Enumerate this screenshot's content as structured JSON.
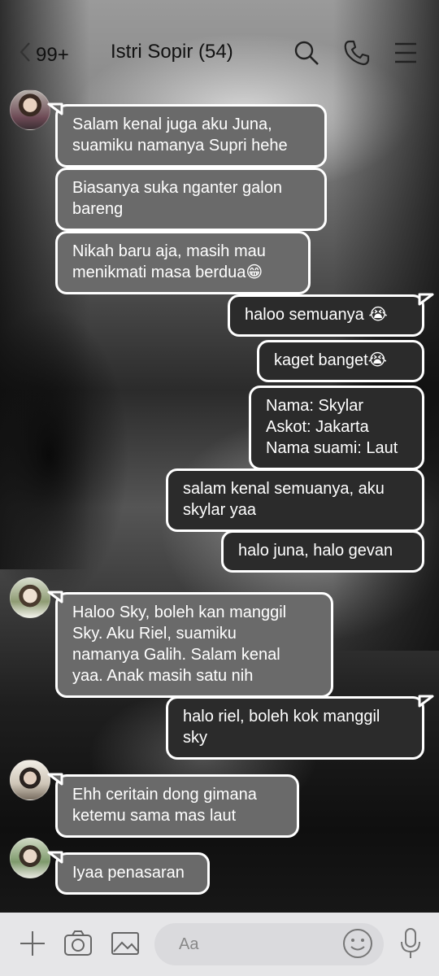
{
  "header": {
    "back_count": "99+",
    "title": "Istri Sopir (54)"
  },
  "messages": [
    {
      "side": "in",
      "text": "Salam kenal juga aku Juna,\nsuamiku namanya Supri hehe"
    },
    {
      "side": "in",
      "text": "Biasanya suka nganter galon\nbareng"
    },
    {
      "side": "in",
      "text": "Nikah baru aja, masih mau\nmenikmati masa berdua😁"
    },
    {
      "side": "out",
      "text": "haloo semuanya 😭"
    },
    {
      "side": "out",
      "text": "kaget banget😭"
    },
    {
      "side": "out",
      "text": "Nama: Skylar\nAskot: Jakarta\nNama suami: Laut"
    },
    {
      "side": "out",
      "text": "salam kenal semuanya, aku\nskylar yaa"
    },
    {
      "side": "out",
      "text": "halo juna, halo gevan"
    },
    {
      "side": "in",
      "text": "Haloo Sky, boleh kan manggil\nSky. Aku Riel, suamiku\nnamanya Galih. Salam kenal\nyaa. Anak masih satu nih"
    },
    {
      "side": "out",
      "text": "halo riel, boleh kok manggil\nsky"
    },
    {
      "side": "in",
      "text": "Ehh ceritain dong gimana\nketemu sama mas laut"
    },
    {
      "side": "in",
      "text": "Iyaa penasaran"
    }
  ],
  "composer": {
    "placeholder": "Aa"
  },
  "icons": [
    "chevron-left-icon",
    "search-icon",
    "phone-icon",
    "menu-icon",
    "plus-icon",
    "camera-icon",
    "image-icon",
    "emoji-icon",
    "microphone-icon"
  ]
}
